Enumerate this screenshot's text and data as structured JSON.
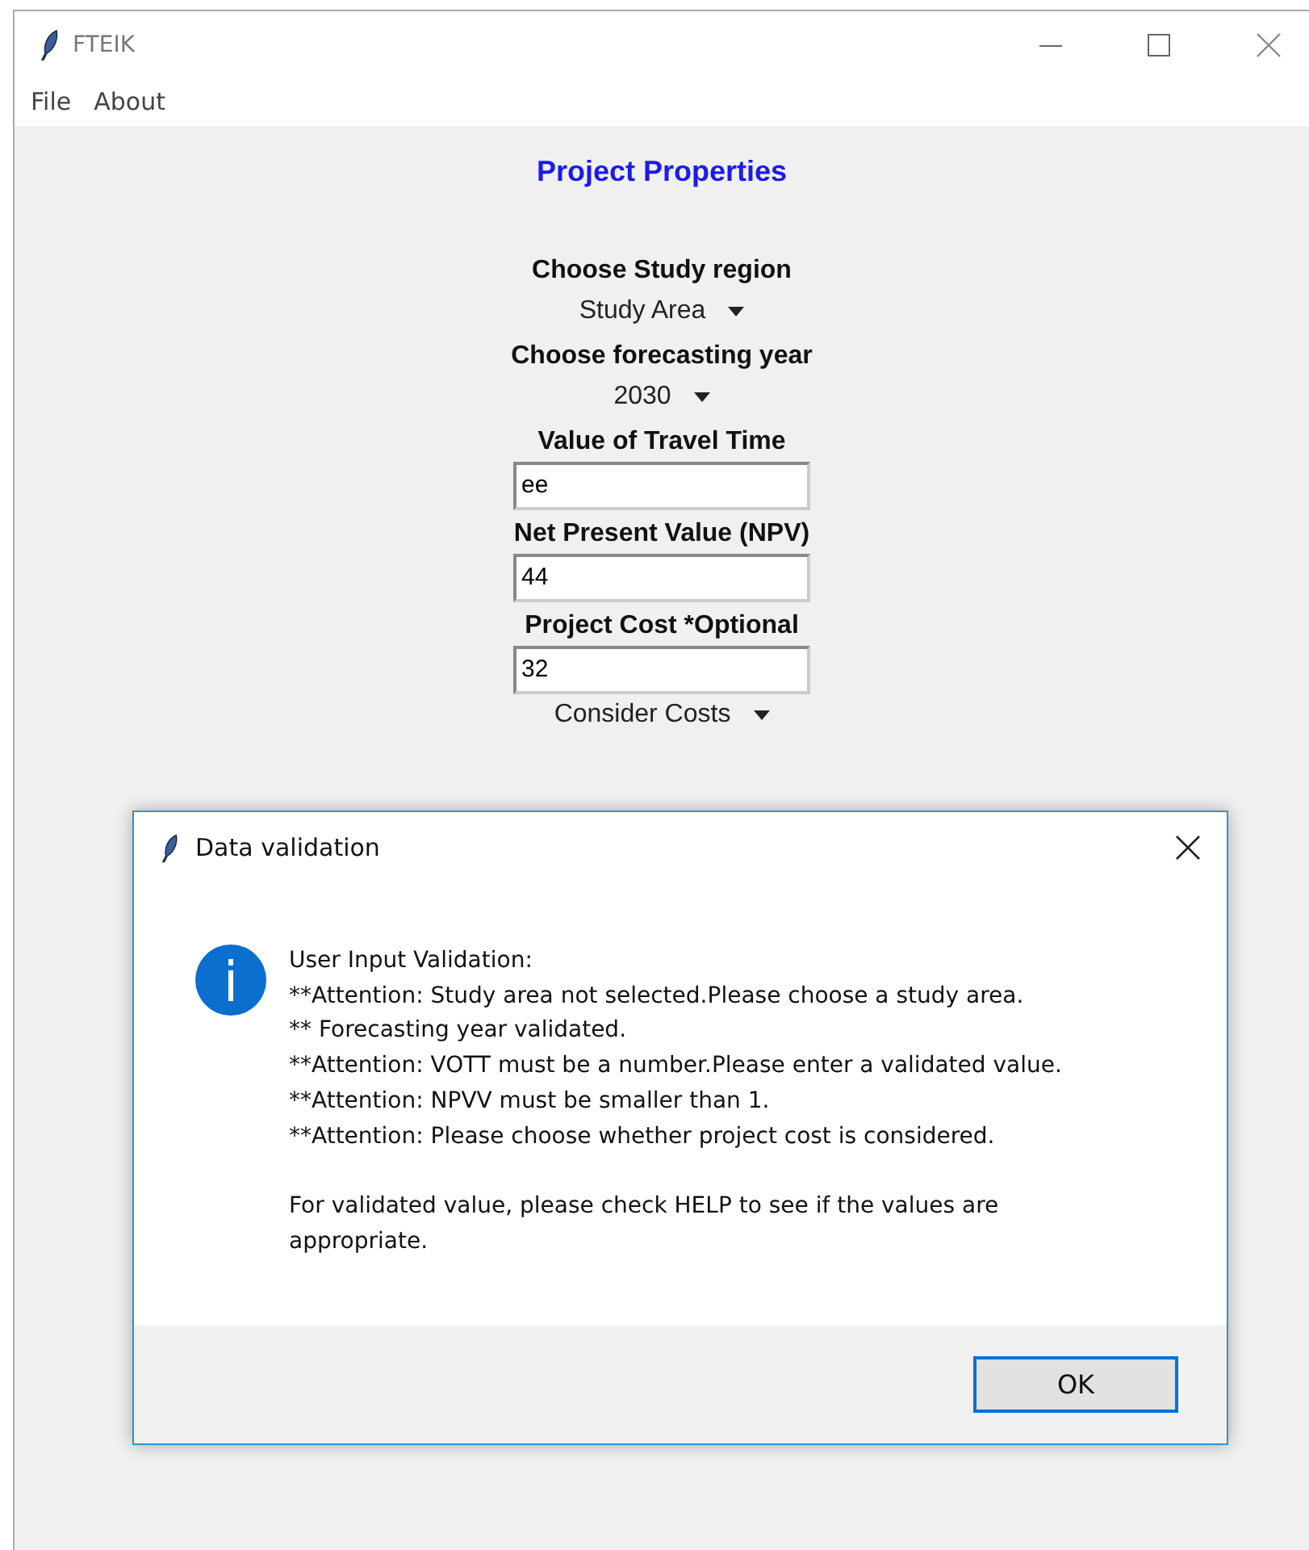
{
  "window": {
    "title": "FTEIK"
  },
  "menu": [
    "File",
    "About"
  ],
  "heading": "Project Properties",
  "form": [
    {
      "kind": "label",
      "text": "Choose Study region"
    },
    {
      "kind": "dropdown",
      "text": "Study Area"
    },
    {
      "kind": "label",
      "text": "Choose forecasting year"
    },
    {
      "kind": "dropdown",
      "text": "2030"
    },
    {
      "kind": "label",
      "text": "Value of Travel Time"
    },
    {
      "kind": "entry",
      "text": "ee"
    },
    {
      "kind": "label",
      "text": "Net Present Value (NPV)"
    },
    {
      "kind": "entry",
      "text": "44"
    },
    {
      "kind": "label",
      "text": "Project Cost *Optional"
    },
    {
      "kind": "entry",
      "text": "32"
    },
    {
      "kind": "dropdown",
      "text": "Consider Costs"
    }
  ],
  "dialog": {
    "title": "Data validation",
    "message_lines": [
      "User Input Validation:",
      "**Attention: Study area not selected.Please choose a study area.",
      "** Forecasting year validated.",
      "**Attention: VOTT must be a number.Please enter a validated value.",
      "**Attention: NPVV must be smaller than 1.",
      "**Attention: Please choose whether project cost is considered."
    ],
    "note": "For validated value, please check HELP to see if the values are appropriate.",
    "button": "OK"
  }
}
